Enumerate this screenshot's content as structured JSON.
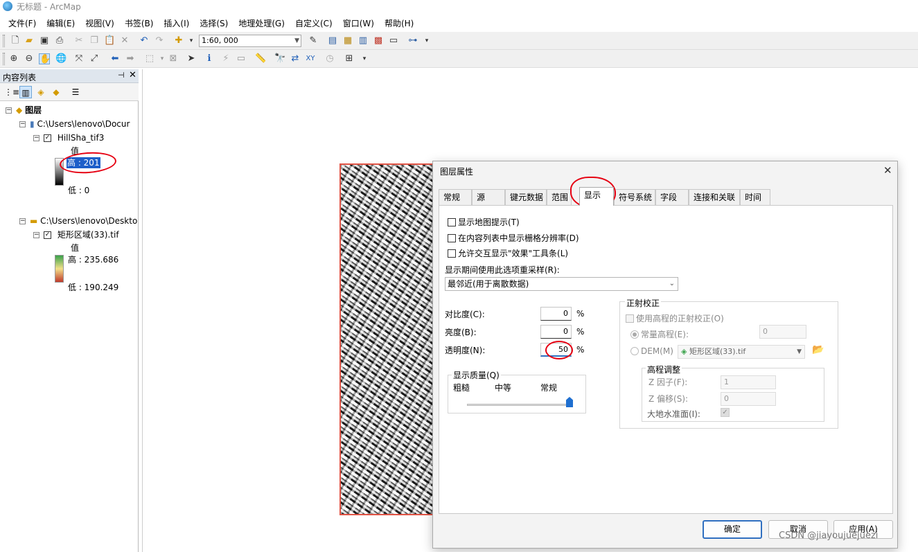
{
  "window": {
    "title": "无标题 - ArcMap"
  },
  "menu": [
    "文件(F)",
    "编辑(E)",
    "视图(V)",
    "书签(B)",
    "插入(I)",
    "选择(S)",
    "地理处理(G)",
    "自定义(C)",
    "窗口(W)",
    "帮助(H)"
  ],
  "toolbar": {
    "scale": "1:60, 000"
  },
  "toc": {
    "title": "内容列表",
    "root_label": "图层",
    "groups": [
      {
        "path": "C:\\Users\\lenovo\\Docur",
        "layer": "HillSha_tif3",
        "value_label": "值",
        "high": "高 : 201",
        "low": "低 : 0"
      },
      {
        "path": "C:\\Users\\lenovo\\Deskto",
        "layer": "矩形区域(33).tif",
        "value_label": "值",
        "high": "高 : 235.686",
        "low": "低 : 190.249"
      }
    ]
  },
  "dialog": {
    "title": "图层属性",
    "tabs": [
      "常规",
      "源",
      "键元数据",
      "范围",
      "显示",
      "符号系统",
      "字段",
      "连接和关联",
      "时间"
    ],
    "active_tab": "显示",
    "checkboxes": [
      "显示地图提示(T)",
      "在内容列表中显示栅格分辨率(D)",
      "允许交互显示\"效果\"工具条(L)"
    ],
    "resample_label": "显示期间使用此选项重采样(R):",
    "resample_value": "最邻近(用于离散数据)",
    "contrast_label": "对比度(C):",
    "contrast_value": "0",
    "brightness_label": "亮度(B):",
    "brightness_value": "0",
    "transparency_label": "透明度(N):",
    "transparency_value": "50",
    "percent": "%",
    "quality": {
      "title": "显示质量(Q)",
      "coarse": "粗糙",
      "medium": "中等",
      "normal": "常规",
      "level": 1.0
    },
    "ortho": {
      "title": "正射校正",
      "use_elev": "使用高程的正射校正(O)",
      "const_elev": "常量高程(E):",
      "const_value": "0",
      "dem": "DEM(M)",
      "dem_value": "矩形区域(33).tif",
      "elev_adjust": "高程调整",
      "z_factor": "Z 因子(F):",
      "z_factor_value": "1",
      "z_offset": "Z 偏移(S):",
      "z_offset_value": "0",
      "geoid": "大地水准面(I):"
    },
    "buttons": {
      "ok": "确定",
      "cancel": "取消",
      "apply": "应用(A)"
    }
  },
  "watermark": "CSDN @jiayoujuejuezi",
  "colors": {
    "accent": "#2f6fc0",
    "annotation": "#e60012"
  }
}
